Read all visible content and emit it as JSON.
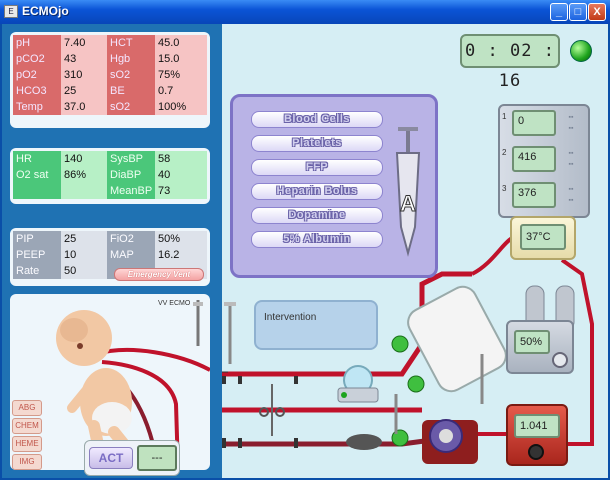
{
  "window": {
    "title": "ECMOjo",
    "min": "_",
    "max": "□",
    "close": "X"
  },
  "bloodgas": {
    "rows": [
      [
        "pH",
        "7.40",
        "HCT",
        "45.0"
      ],
      [
        "pCO2",
        "43",
        "Hgb",
        "15.0"
      ],
      [
        "pO2",
        "310",
        "sO2",
        "75%"
      ],
      [
        "HCO3",
        "25",
        "BE",
        "0.7"
      ],
      [
        "Temp",
        "37.0",
        "sO2",
        "100%"
      ]
    ]
  },
  "vitals": {
    "rows": [
      [
        "HR",
        "140",
        "SysBP",
        "58"
      ],
      [
        "O2 sat",
        "86%",
        "DiaBP",
        "40"
      ],
      [
        "",
        "",
        "MeanBP",
        "73"
      ]
    ]
  },
  "vent": {
    "rows": [
      [
        "PIP",
        "25",
        "FiO2",
        "50%"
      ],
      [
        "PEEP",
        "10",
        "MAP",
        "16.2"
      ],
      [
        "Rate",
        "50",
        "",
        ""
      ]
    ],
    "emergency_label": "Emergency Vent"
  },
  "patient": {
    "mode": "VV ECMO",
    "side_buttons": [
      "ABG",
      "CHEM",
      "HEME",
      "IMG"
    ]
  },
  "act": {
    "label": "ACT",
    "value": "---"
  },
  "timer": "0 : 02 : 16",
  "meds": {
    "items": [
      "Blood Cells",
      "Platelets",
      "FFP",
      "Heparin Bolus",
      "Dopamine",
      "5% Albumin"
    ],
    "syringe_label": "A"
  },
  "intervention": {
    "label": "Intervention"
  },
  "pump": {
    "rows": [
      {
        "num": "1",
        "value": "0"
      },
      {
        "num": "2",
        "value": "416"
      },
      {
        "num": "3",
        "value": "376"
      }
    ]
  },
  "heater": {
    "value": "37°C"
  },
  "gas": {
    "value": "50%"
  },
  "flow": {
    "value": "1.041"
  },
  "circuit": {
    "clamp_labels": [
      "3",
      "2",
      "1"
    ]
  },
  "colors": {
    "arterial": "#c0122b",
    "venous": "#8a1d2e",
    "status_ok": "#1ea41e",
    "panel_blue": "#1f72b3"
  }
}
